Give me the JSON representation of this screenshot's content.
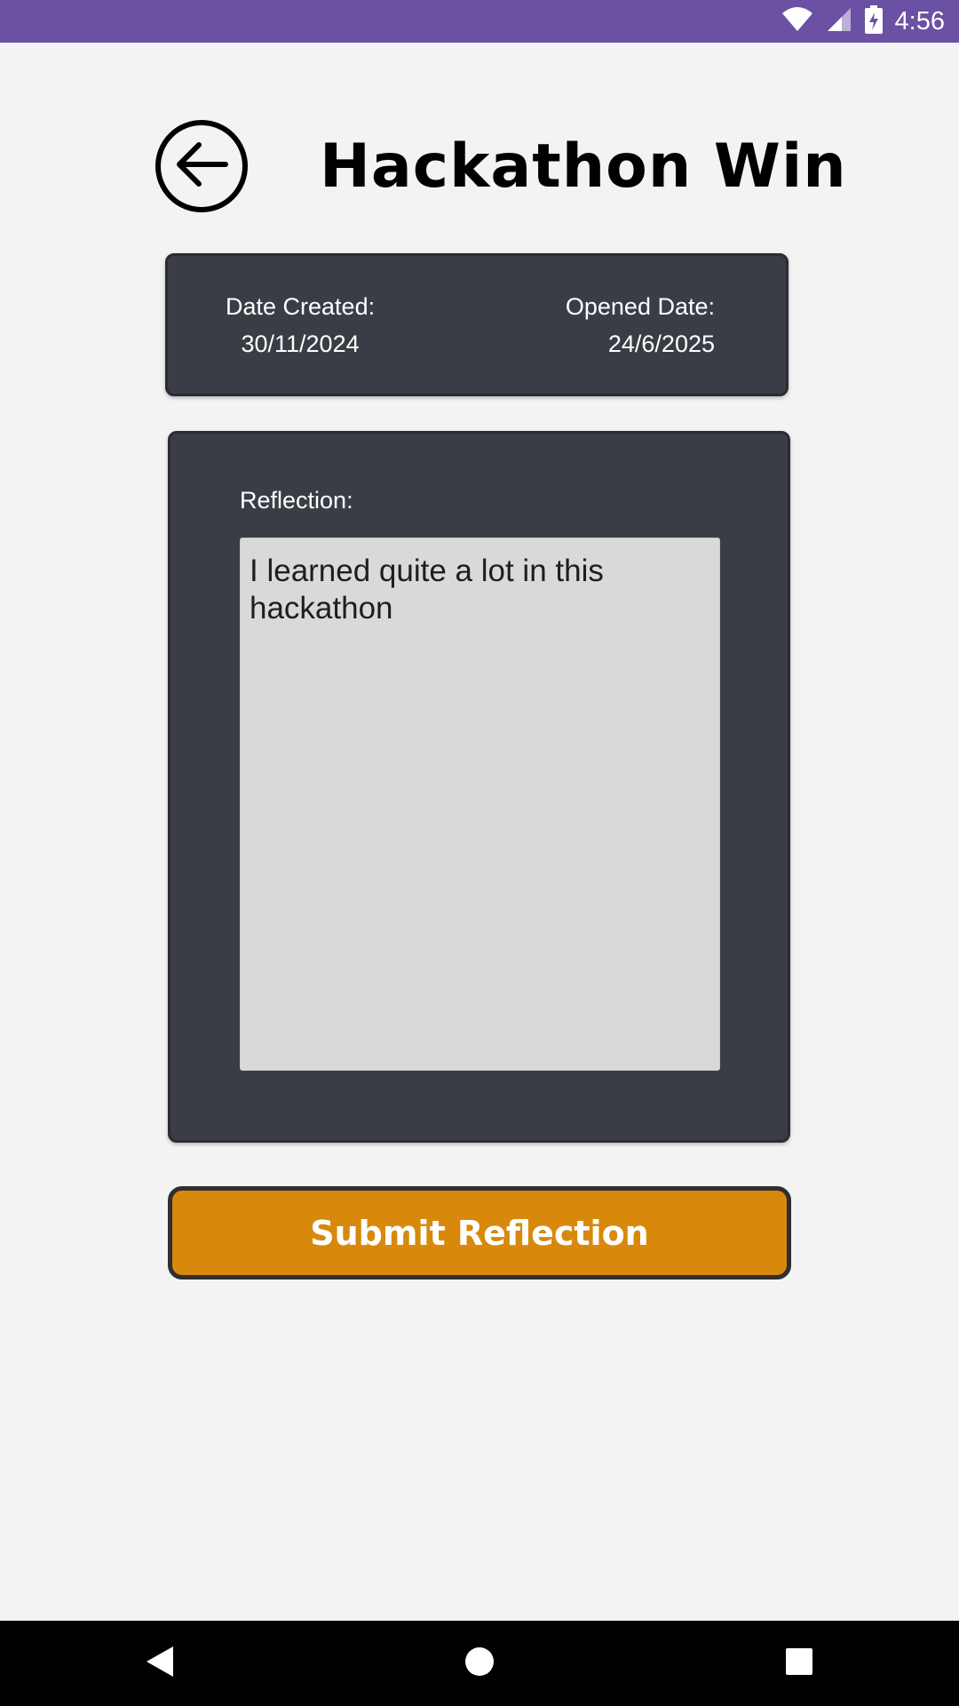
{
  "status_bar": {
    "time": "4:56",
    "icons": [
      "wifi-icon",
      "signal-icon",
      "battery-charging-icon"
    ],
    "color": "#6a51a3"
  },
  "header": {
    "back_icon": "arrow-left-circle-icon",
    "title": "Hackathon Win"
  },
  "dates": {
    "created_label": "Date Created:",
    "created_value": "30/11/2024",
    "opened_label": "Opened Date:",
    "opened_value": "24/6/2025"
  },
  "reflection": {
    "label": "Reflection:",
    "value": "I learned quite a lot in this hackathon"
  },
  "submit": {
    "label": "Submit Reflection",
    "color": "#d8890c"
  },
  "nav_bar": {
    "icons": [
      "nav-back-icon",
      "nav-home-icon",
      "nav-recents-icon"
    ]
  }
}
